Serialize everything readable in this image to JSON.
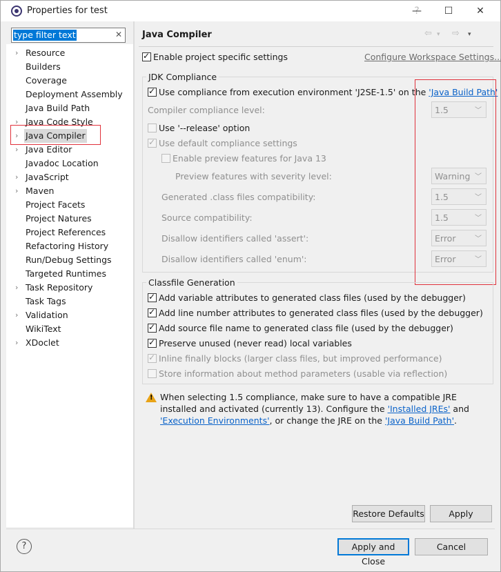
{
  "window": {
    "title": "Properties for test"
  },
  "titlebar": {
    "help": "?",
    "min": "—",
    "max": "☐",
    "close": "✕"
  },
  "filter": {
    "value": "type filter text",
    "clear": "✕"
  },
  "tree": [
    {
      "label": "Resource",
      "arrow": "›"
    },
    {
      "label": "Builders",
      "arrow": ""
    },
    {
      "label": "Coverage",
      "arrow": ""
    },
    {
      "label": "Deployment Assembly",
      "arrow": ""
    },
    {
      "label": "Java Build Path",
      "arrow": ""
    },
    {
      "label": "Java Code Style",
      "arrow": "›"
    },
    {
      "label": "Java Compiler",
      "arrow": "›"
    },
    {
      "label": "Java Editor",
      "arrow": "›"
    },
    {
      "label": "Javadoc Location",
      "arrow": ""
    },
    {
      "label": "JavaScript",
      "arrow": "›"
    },
    {
      "label": "Maven",
      "arrow": "›"
    },
    {
      "label": "Project Facets",
      "arrow": ""
    },
    {
      "label": "Project Natures",
      "arrow": ""
    },
    {
      "label": "Project References",
      "arrow": ""
    },
    {
      "label": "Refactoring History",
      "arrow": ""
    },
    {
      "label": "Run/Debug Settings",
      "arrow": ""
    },
    {
      "label": "Targeted Runtimes",
      "arrow": ""
    },
    {
      "label": "Task Repository",
      "arrow": "›"
    },
    {
      "label": "Task Tags",
      "arrow": ""
    },
    {
      "label": "Validation",
      "arrow": "›"
    },
    {
      "label": "WikiText",
      "arrow": ""
    },
    {
      "label": "XDoclet",
      "arrow": "›"
    }
  ],
  "page": {
    "title": "Java Compiler",
    "nav_back": "⇦",
    "nav_forward": "⇨",
    "nav_menu": "▾",
    "enable_specific": "Enable project specific settings",
    "configure_workspace": "Configure Workspace Settings..."
  },
  "jdk": {
    "group_title": "JDK Compliance",
    "use_compliance_prefix": "Use compliance from execution environment 'J2SE-1.5' on the ",
    "java_build_path_link": "'Java Build Path'",
    "compiler_level_label": "Compiler compliance level:",
    "compiler_level_value": "1.5",
    "release_option": "Use '--release' option",
    "default_compliance": "Use default compliance settings",
    "preview_features": "Enable preview features for Java 13",
    "preview_severity_label": "Preview features with severity level:",
    "preview_severity_value": "Warning",
    "generated_label": "Generated .class files compatibility:",
    "generated_value": "1.5",
    "source_label": "Source compatibility:",
    "source_value": "1.5",
    "assert_label": "Disallow identifiers called 'assert':",
    "assert_value": "Error",
    "enum_label": "Disallow identifiers called 'enum':",
    "enum_value": "Error",
    "dropdown_arrow": "﹀"
  },
  "classfile": {
    "group_title": "Classfile Generation",
    "options": [
      "Add variable attributes to generated class files (used by the debugger)",
      "Add line number attributes to generated class files (used by the debugger)",
      "Add source file name to generated class file (used by the debugger)",
      "Preserve unused (never read) local variables",
      "Inline finally blocks (larger class files, but improved performance)",
      "Store information about method parameters (usable via reflection)"
    ]
  },
  "warning": {
    "icon_glyph": "!",
    "text_1": "When selecting 1.5 compliance, make sure to have a compatible JRE installed and activated (currently 13). Configure the ",
    "link_installed": "'Installed JREs'",
    "text_2": " and ",
    "link_exec": "'Execution Environments'",
    "text_3": ", or change the JRE on the ",
    "link_build_path": "'Java Build Path'",
    "text_4": "."
  },
  "buttons": {
    "restore_defaults": "Restore Defaults",
    "apply": "Apply",
    "apply_close": "Apply and Close",
    "cancel": "Cancel",
    "help": "?"
  }
}
